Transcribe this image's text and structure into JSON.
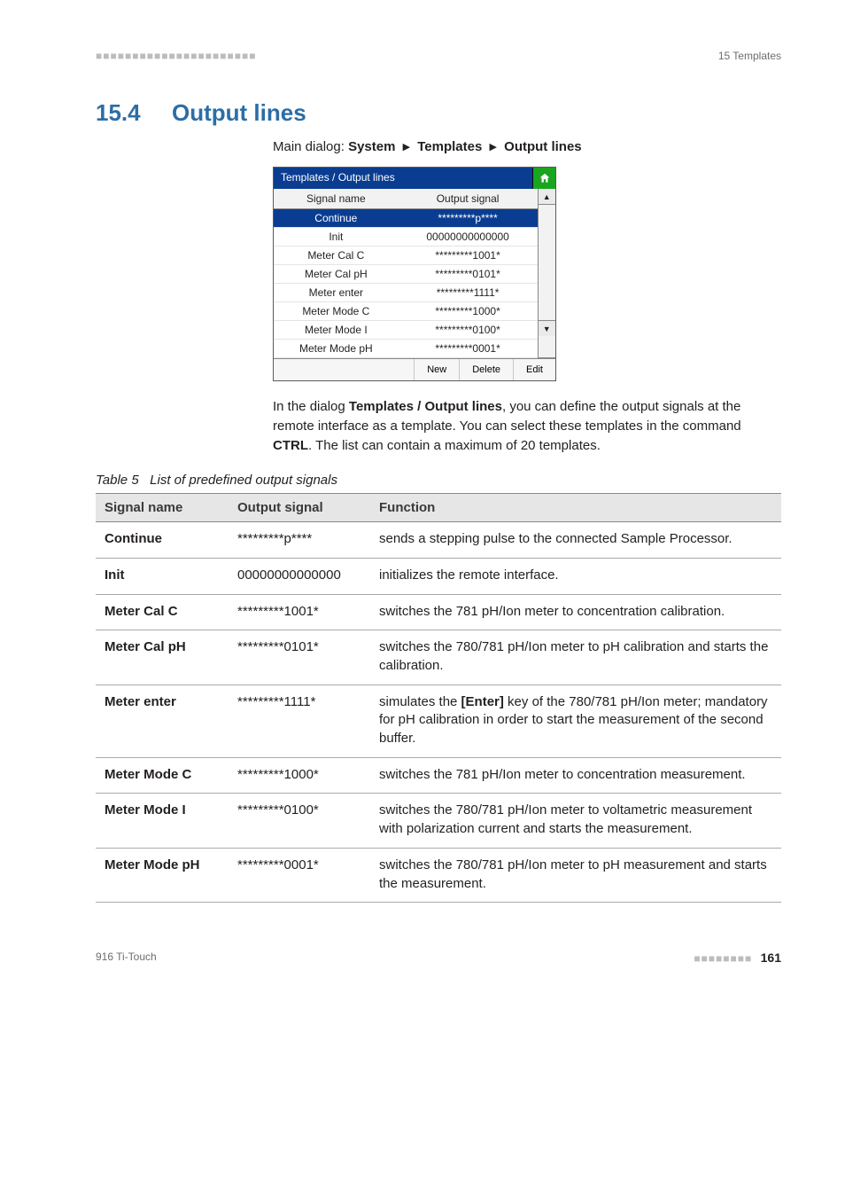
{
  "runhead": {
    "left_dots": "■■■■■■■■■■■■■■■■■■■■■■",
    "right": "15 Templates"
  },
  "section": {
    "number": "15.4",
    "title": "Output lines"
  },
  "breadcrumb": {
    "lead": "Main dialog: ",
    "p1": "System",
    "p2": "Templates",
    "p3": "Output lines"
  },
  "dialog": {
    "title": "Templates / Output lines",
    "col1": "Signal name",
    "col2": "Output signal",
    "rows": [
      {
        "name": "Continue",
        "sig": "*********p****",
        "sel": true
      },
      {
        "name": "Init",
        "sig": "00000000000000"
      },
      {
        "name": "Meter Cal C",
        "sig": "*********1001*"
      },
      {
        "name": "Meter Cal pH",
        "sig": "*********0101*"
      },
      {
        "name": "Meter enter",
        "sig": "*********1111*"
      },
      {
        "name": "Meter Mode C",
        "sig": "*********1000*"
      },
      {
        "name": "Meter Mode I",
        "sig": "*********0100*"
      },
      {
        "name": "Meter Mode pH",
        "sig": "*********0001*"
      }
    ],
    "btn_new": "New",
    "btn_delete": "Delete",
    "btn_edit": "Edit"
  },
  "para": {
    "t1": "In the dialog ",
    "b1": "Templates / Output lines",
    "t2": ", you can define the output signals at the remote interface as a template. You can select these templates in the command ",
    "b2": "CTRL",
    "t3": ". The list can contain a maximum of 20 templates."
  },
  "tablecap": {
    "num": "Table 5",
    "txt": "List of predefined output signals"
  },
  "sig_headers": {
    "c1": "Signal name",
    "c2": "Output signal",
    "c3": "Function"
  },
  "sig_rows": [
    {
      "name": "Continue",
      "osig": "*********p****",
      "func_pre": "sends a stepping pulse to the connected Sample Processor."
    },
    {
      "name": "Init",
      "osig": "00000000000000",
      "func_pre": "initializes the remote interface."
    },
    {
      "name": "Meter Cal C",
      "osig": "*********1001*",
      "func_pre": "switches the 781 pH/Ion meter to concentration calibration."
    },
    {
      "name": "Meter Cal pH",
      "osig": "*********0101*",
      "func_pre": "switches the 780/781 pH/Ion meter to pH calibration and starts the calibration."
    },
    {
      "name": "Meter enter",
      "osig": "*********1111*",
      "func_pre": "simulates the ",
      "func_bold": "[Enter]",
      "func_post": " key of the 780/781 pH/Ion meter; mandatory for pH calibration in order to start the measurement of the second buffer."
    },
    {
      "name": "Meter Mode C",
      "osig": "*********1000*",
      "func_pre": "switches the 781 pH/Ion meter to concentration measurement."
    },
    {
      "name": "Meter Mode I",
      "osig": "*********0100*",
      "func_pre": "switches the 780/781 pH/Ion meter to voltametric measurement with polarization current and starts the measurement."
    },
    {
      "name": "Meter Mode pH",
      "osig": "*********0001*",
      "func_pre": "switches the 780/781 pH/Ion meter to pH measurement and starts the measurement."
    }
  ],
  "footer": {
    "left": "916 Ti-Touch",
    "dots": "■■■■■■■■",
    "page": "161"
  }
}
